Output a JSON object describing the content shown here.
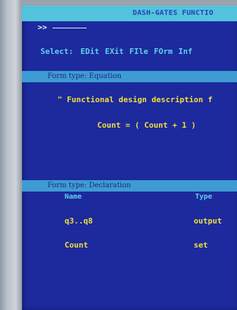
{
  "app": {
    "title": "DASH-GATES  FUNCTIO"
  },
  "command": {
    "prompt": ">>"
  },
  "menu": {
    "label": "Select:",
    "items": [
      "EDit",
      "EXit",
      "FIle",
      "FOrm",
      "Inf"
    ]
  },
  "equation_form": {
    "header": "Form type: Equation",
    "description": "\" Functional design description f",
    "formula": "Count = ( Count + 1 )"
  },
  "declaration_form": {
    "header": "Form type: Declaration",
    "columns": [
      "Name",
      "Type"
    ],
    "rows": [
      {
        "name": "q3..q8",
        "type": "output"
      },
      {
        "name": "Count",
        "type": "set"
      }
    ]
  },
  "colors": {
    "screen_background": "#1d2aa0",
    "title_bar": "#54c7e0",
    "section_bar": "#3f9ed6",
    "highlight_text": "#f3e23a",
    "menu_text": "#5fd5ef"
  }
}
